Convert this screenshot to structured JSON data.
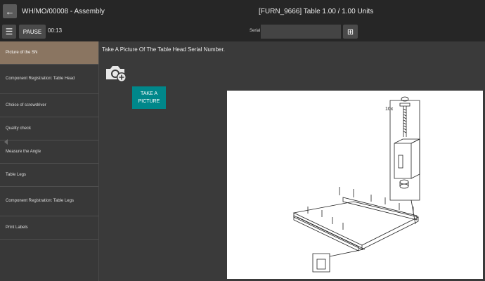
{
  "header": {
    "back_icon": "arrow-left-icon",
    "work_order": "WH/MO/00008 - Assembly",
    "product": "[FURN_9666] Table 1.00 / 1.00 Units"
  },
  "toolbar": {
    "menu_icon": "hamburger-icon",
    "pause_label": "PAUSE",
    "timer": "00:13",
    "serial_label": "Serial",
    "serial_value": "",
    "serial_button_icon": "add-square-icon"
  },
  "sidebar": {
    "steps": [
      {
        "label": "Picture of the SN",
        "active": true
      },
      {
        "label": "Component Registration: Table Head",
        "active": false
      },
      {
        "label": "Choice of screwdriver",
        "active": false
      },
      {
        "label": "Quality check",
        "active": false
      },
      {
        "label": "Measure the Angle",
        "active": false
      },
      {
        "label": "Table Legs",
        "active": false
      },
      {
        "label": "Component Registration: Table Legs",
        "active": false
      },
      {
        "label": "Print Labels",
        "active": false
      }
    ]
  },
  "main": {
    "instruction": "Take A Picture Of The Table Head Serial Number.",
    "camera_icon": "camera-add-icon",
    "take_picture_line1": "TAKE A",
    "take_picture_line2": "PICTURE",
    "diagram": {
      "qty_label": "10x"
    }
  },
  "colors": {
    "topbar": "#262626",
    "active_step": "#8a7561",
    "accent": "#00878a"
  }
}
